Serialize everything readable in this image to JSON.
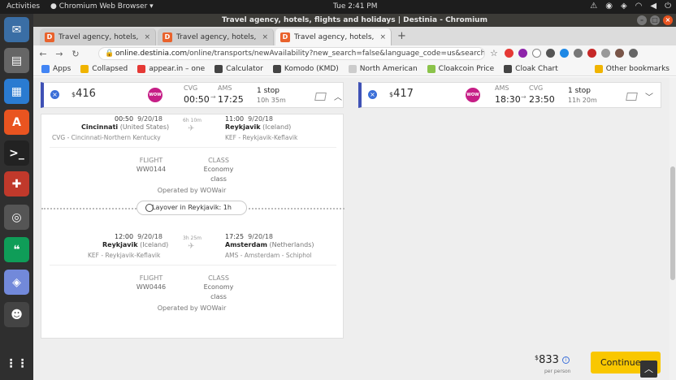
{
  "system": {
    "activities": "Activities",
    "app_name": "Chromium Web Browser",
    "clock": "Tue  2:41 PM"
  },
  "window": {
    "title": "Travel agency, hotels, flights and holidays | Destinia - Chromium"
  },
  "tabs": [
    {
      "label": "Travel agency, hotels, flig",
      "favicon": "D"
    },
    {
      "label": "Travel agency, hotels, flig",
      "favicon": "D"
    },
    {
      "label": "Travel agency, hotels, flig",
      "favicon": "D"
    }
  ],
  "omnibox": {
    "domain": "online.destinia.com",
    "path": "/online/transports/newAvailability?new_search=false&language_code=us&search_sID="
  },
  "bookmarks": {
    "apps": "Apps",
    "items": [
      "Collapsed",
      "appear.in – one",
      "Calculator",
      "Komodo (KMD)",
      "North American",
      "Cloakcoin Price",
      "Cloak Chart"
    ],
    "other": "Other bookmarks"
  },
  "outbound": {
    "price_symbol": "$",
    "price": "416",
    "airline": "WOW",
    "dep_code": "CVG",
    "arr_code": "AMS",
    "dep_time": "00:50",
    "arr_time": "17:25",
    "arrow": "→",
    "stops": "1 stop",
    "duration": "10h 35m"
  },
  "return": {
    "price_symbol": "$",
    "price": "417",
    "airline": "WOW",
    "dep_code": "AMS",
    "arr_code": "CVG",
    "dep_time": "18:30",
    "arr_time": "23:50",
    "arrow": "→",
    "stops": "1 stop",
    "duration": "11h 20m"
  },
  "segments": [
    {
      "dep_time": "00:50",
      "dep_date": "9/20/18",
      "dep_city": "Cincinnati",
      "dep_country": "(United States)",
      "dep_airport": "CVG - Cincinnati-Northern Kentucky",
      "duration": "6h 10m",
      "arr_time": "11:00",
      "arr_date": "9/20/18",
      "arr_city": "Reykjavik",
      "arr_country": "(Iceland)",
      "arr_airport": "KEF - Reykjavik-Keflavik",
      "flight_label": "FLIGHT",
      "flight": "WW0144",
      "class_label": "CLASS",
      "class_line1": "Economy",
      "class_line2": "class",
      "operated": "Operated by WOWair"
    },
    {
      "dep_time": "12:00",
      "dep_date": "9/20/18",
      "dep_city": "Reykjavik",
      "dep_country": "(Iceland)",
      "dep_airport": "KEF - Reykjavik-Keflavik",
      "duration": "3h 25m",
      "arr_time": "17:25",
      "arr_date": "9/20/18",
      "arr_city": "Amsterdam",
      "arr_country": "(Netherlands)",
      "arr_airport": "AMS - Amsterdam - Schiphol",
      "flight_label": "FLIGHT",
      "flight": "WW0446",
      "class_label": "CLASS",
      "class_line1": "Economy",
      "class_line2": "class",
      "operated": "Operated by WOWair"
    }
  ],
  "layover": "Layover in Reykjavik: 1h",
  "summary": {
    "currency": "$",
    "total": "833",
    "per_person": "per person",
    "continue": "Continue"
  },
  "colors": {
    "accent": "#3f51b5",
    "wow": "#c61e86",
    "continue": "#f9c700"
  }
}
